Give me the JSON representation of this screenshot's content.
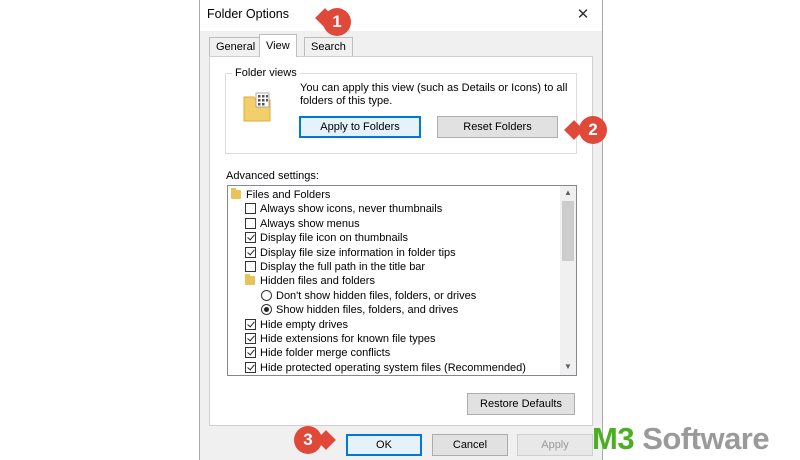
{
  "window": {
    "title": "Folder Options",
    "close_glyph": "✕"
  },
  "tabs": [
    {
      "label": "General",
      "selected": false
    },
    {
      "label": "View",
      "selected": true
    },
    {
      "label": "Search",
      "selected": false
    }
  ],
  "folder_views": {
    "label": "Folder views",
    "description": "You can apply this view (such as Details or Icons) to all folders of this type.",
    "apply_button": "Apply to Folders",
    "reset_button": "Reset Folders"
  },
  "advanced": {
    "label": "Advanced settings:",
    "items": [
      {
        "type": "folder",
        "label": "Files and Folders",
        "indent": 0
      },
      {
        "type": "checkbox",
        "label": "Always show icons, never thumbnails",
        "checked": false,
        "indent": 1
      },
      {
        "type": "checkbox",
        "label": "Always show menus",
        "checked": false,
        "indent": 1
      },
      {
        "type": "checkbox",
        "label": "Display file icon on thumbnails",
        "checked": true,
        "indent": 1
      },
      {
        "type": "checkbox",
        "label": "Display file size information in folder tips",
        "checked": true,
        "indent": 1
      },
      {
        "type": "checkbox",
        "label": "Display the full path in the title bar",
        "checked": false,
        "indent": 1
      },
      {
        "type": "folder",
        "label": "Hidden files and folders",
        "indent": 1
      },
      {
        "type": "radio",
        "label": "Don't show hidden files, folders, or drives",
        "checked": false,
        "indent": 2
      },
      {
        "type": "radio",
        "label": "Show hidden files, folders, and drives",
        "checked": true,
        "indent": 2
      },
      {
        "type": "checkbox",
        "label": "Hide empty drives",
        "checked": true,
        "indent": 1
      },
      {
        "type": "checkbox",
        "label": "Hide extensions for known file types",
        "checked": true,
        "indent": 1
      },
      {
        "type": "checkbox",
        "label": "Hide folder merge conflicts",
        "checked": true,
        "indent": 1
      },
      {
        "type": "checkbox",
        "label": "Hide protected operating system files (Recommended)",
        "checked": true,
        "indent": 1
      }
    ]
  },
  "buttons": {
    "restore_defaults": "Restore Defaults",
    "ok": "OK",
    "cancel": "Cancel",
    "apply": "Apply"
  },
  "callouts": [
    "1",
    "2",
    "3"
  ],
  "watermark": {
    "brand_a": "M3",
    "brand_b": " Software"
  },
  "colors": {
    "callout": "#e0483a",
    "watermark_green": "#4caf22",
    "focus": "#0078d7"
  }
}
